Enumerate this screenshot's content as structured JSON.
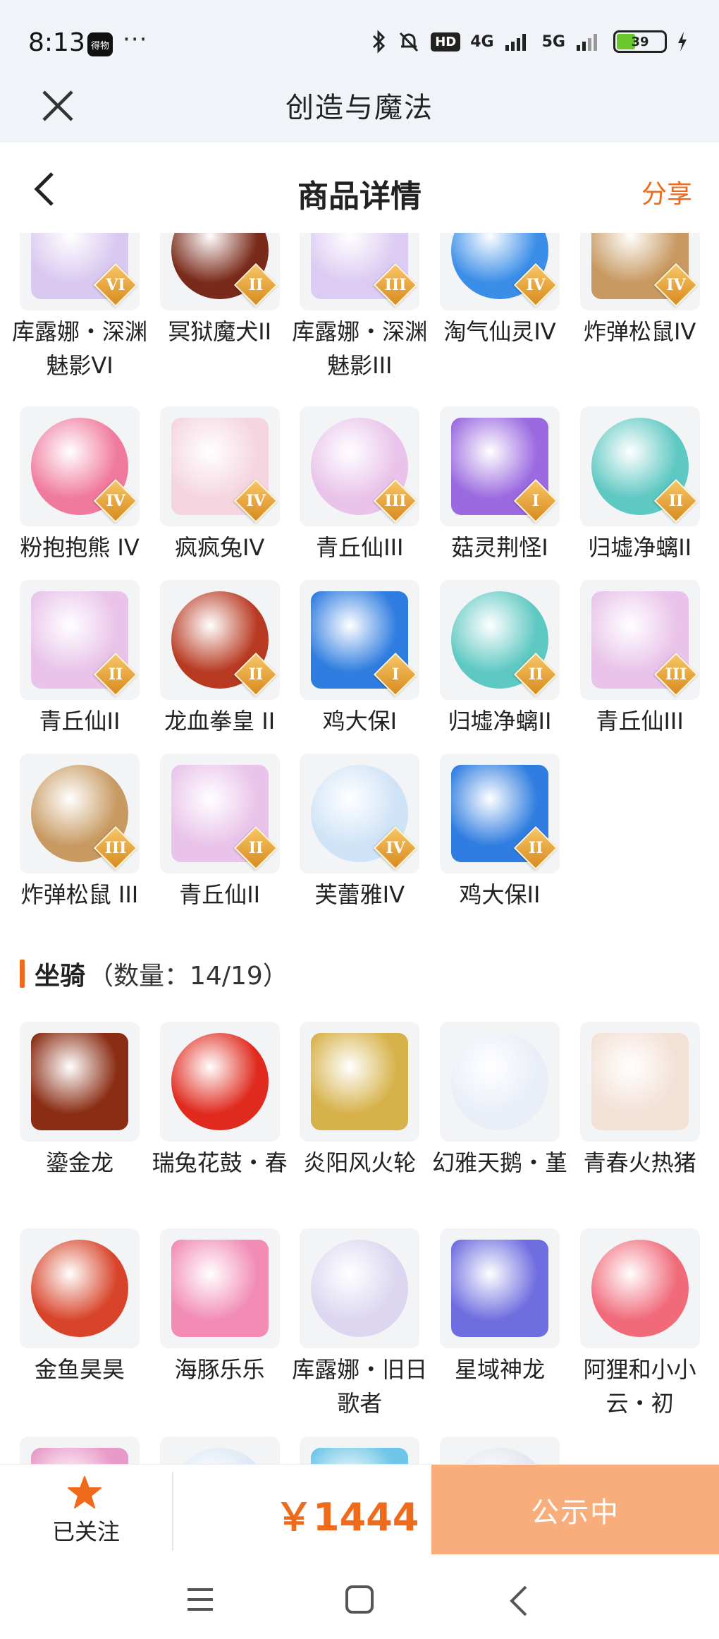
{
  "status": {
    "time": "8:13",
    "app_badge": "得物",
    "dots": "···",
    "hd": "HD",
    "net1": "4G",
    "net2": "5G",
    "battery": "39",
    "battery_level": 0.39
  },
  "app_header": {
    "title": "创造与魔法"
  },
  "page_header": {
    "title": "商品详情",
    "share": "分享"
  },
  "pets": [
    {
      "name": "库露娜・深渊魅影VI",
      "tier": "VI",
      "color": "#d9c8f0"
    },
    {
      "name": "冥狱魔犬II",
      "tier": "II",
      "color": "#7a2a1a"
    },
    {
      "name": "库露娜・深渊魅影III",
      "tier": "III",
      "color": "#dccbf2"
    },
    {
      "name": "淘气仙灵IV",
      "tier": "IV",
      "color": "#3a8ee8"
    },
    {
      "name": "炸弹松鼠IV",
      "tier": "IV",
      "color": "#c89a62"
    },
    {
      "name": "粉抱抱熊 IV",
      "tier": "IV",
      "color": "#f07a9e"
    },
    {
      "name": "疯疯兔IV",
      "tier": "IV",
      "color": "#f5d6e0"
    },
    {
      "name": "青丘仙III",
      "tier": "III",
      "color": "#e9c3ea"
    },
    {
      "name": "菇灵荆怪I",
      "tier": "I",
      "color": "#9b6ae0"
    },
    {
      "name": "归墟净螭II",
      "tier": "II",
      "color": "#5ec8c2"
    },
    {
      "name": "青丘仙II",
      "tier": "II",
      "color": "#e9c3ea"
    },
    {
      "name": "龙血拳皇 II",
      "tier": "II",
      "color": "#b83a22"
    },
    {
      "name": "鸡大保I",
      "tier": "I",
      "color": "#2f7de0"
    },
    {
      "name": "归墟净螭II",
      "tier": "II",
      "color": "#5ec8c2"
    },
    {
      "name": "青丘仙III",
      "tier": "III",
      "color": "#e9c3ea"
    },
    {
      "name": "炸弹松鼠 III",
      "tier": "III",
      "color": "#c89a62"
    },
    {
      "name": "青丘仙II",
      "tier": "II",
      "color": "#e9c3ea"
    },
    {
      "name": "芙蕾雅IV",
      "tier": "IV",
      "color": "#cfe3f7"
    },
    {
      "name": "鸡大保II",
      "tier": "II",
      "color": "#2f7de0"
    }
  ],
  "mounts_section": {
    "title": "坐骑",
    "count": "（数量：14/19）"
  },
  "mounts": [
    {
      "name": "鎏金龙",
      "color": "#8a2d14"
    },
    {
      "name": "瑞兔花鼓・春",
      "color": "#e02a1e"
    },
    {
      "name": "炎阳风火轮",
      "color": "#d7b24a"
    },
    {
      "name": "幻雅天鹅・堇",
      "color": "#e9eef8"
    },
    {
      "name": "青春火热猪",
      "color": "#f3e1d6"
    },
    {
      "name": "金鱼昊昊",
      "color": "#d8442a"
    },
    {
      "name": "海豚乐乐",
      "color": "#f28cb5"
    },
    {
      "name": "库露娜・旧日歌者",
      "color": "#dcd6f0"
    },
    {
      "name": "星域神龙",
      "color": "#6f6ee0"
    },
    {
      "name": "阿狸和小小云・初",
      "color": "#f06a7a"
    },
    {
      "name": "",
      "color": "#e89ac8"
    },
    {
      "name": "",
      "color": "#dbe8f5"
    },
    {
      "name": "",
      "color": "#6fc6e8"
    },
    {
      "name": "",
      "color": "#e3e6ef"
    }
  ],
  "bottom": {
    "follow": "已关注",
    "price": "￥1444",
    "status": "公示中"
  },
  "colors": {
    "accent": "#f06a1b",
    "status_button": "#f9ad7b"
  }
}
